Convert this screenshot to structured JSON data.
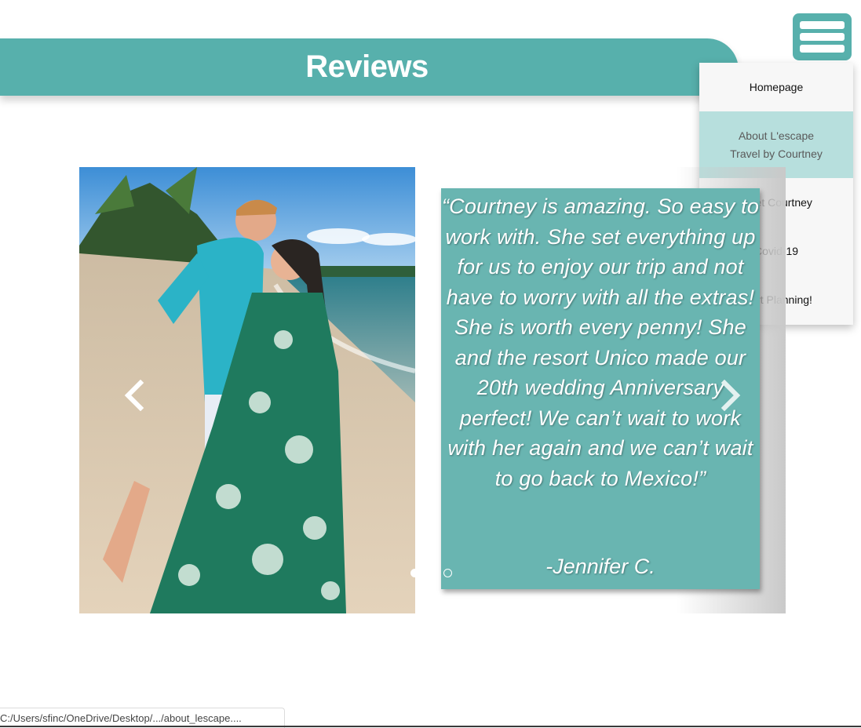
{
  "header": {
    "title": "Reviews"
  },
  "menu": {
    "icon": "hamburger-menu-icon",
    "items": [
      {
        "label": "Homepage"
      },
      {
        "label": "About L'escape\nTravel by Courtney"
      },
      {
        "label": "Meet Courtney"
      },
      {
        "label": "Covid-19"
      },
      {
        "label": "Start Planning!"
      }
    ],
    "active_index": 1
  },
  "carousel": {
    "photo": "couple-kissing-on-beach-photo",
    "review": {
      "quote": "“Courtney is amazing. So easy to work with. She set everything up for us to enjoy our trip and not have to worry with all the extras! She is worth every penny! She and the resort Unico made our 20th wedding Anniversary perfect! We can’t wait to work with her again and we can’t wait to go back to Mexico!”",
      "author": "-Jennifer C."
    },
    "prev_icon": "chevron-left-icon",
    "next_icon": "chevron-right-icon",
    "slide_count": 2,
    "active_slide": 1
  },
  "status_bar": {
    "url": "C:/Users/sfinc/OneDrive/Desktop/.../about_lescape...."
  },
  "colors": {
    "accent": "#57b0ac",
    "card": "#69b5b1",
    "menu_active": "#b7dfdd"
  }
}
